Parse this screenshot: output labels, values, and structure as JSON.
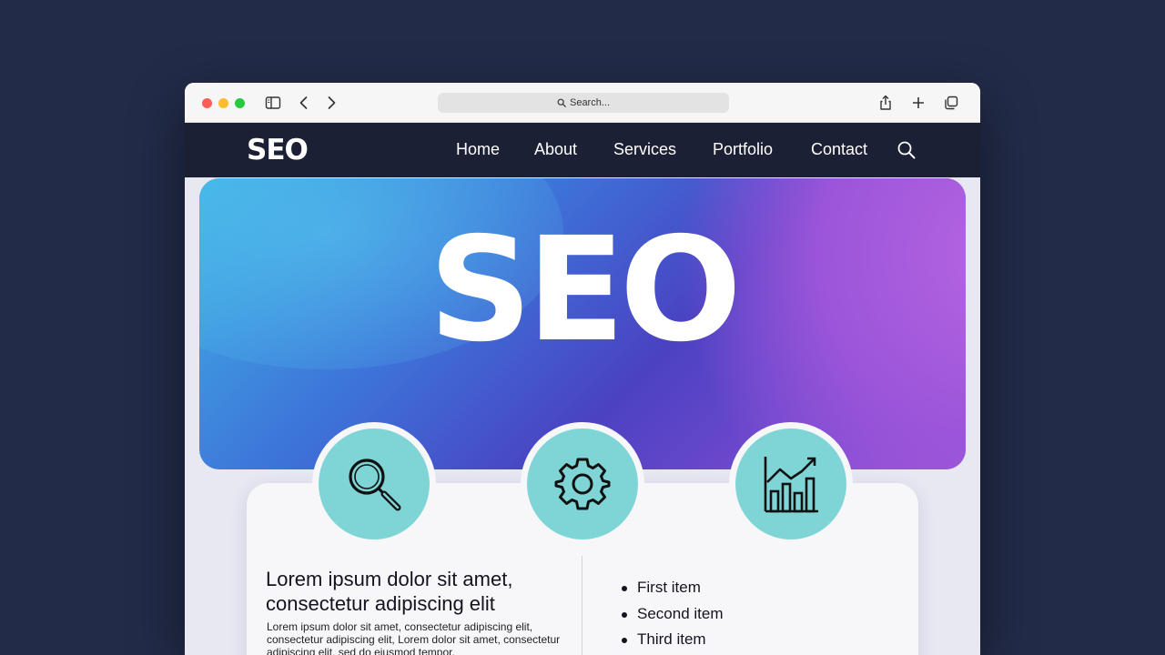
{
  "browser": {
    "address_bar_text": "Search...",
    "icons": [
      "sidebar-icon",
      "back-icon",
      "forward-icon",
      "share-icon",
      "new-tab-icon",
      "tabs-overview-icon"
    ]
  },
  "site_nav": {
    "logo": "SEO",
    "links": [
      "Home",
      "About",
      "Services",
      "Portfolio",
      "Contact"
    ],
    "search_icon": "search-icon"
  },
  "hero": {
    "title": "SEO"
  },
  "features": [
    {
      "icon": "magnifier-icon"
    },
    {
      "icon": "gear-icon"
    },
    {
      "icon": "growth-chart-icon"
    }
  ],
  "content": {
    "heading": "Lorem ipsum dolor sit amet, consectetur adipiscing elit",
    "body": "Lorem ipsum dolor sit amet, consectetur adipiscing elit, consectetur adipiscing elit, Lorem dolor sit amet, consectetur adipiscing elit, sed do eiusmod tempor.",
    "list": [
      "First item",
      "Second item",
      "Third item"
    ]
  },
  "colors": {
    "page_background": "#222b48",
    "navbar": "#1b2034",
    "feature_circle": "#7fd5d6",
    "hero_gradient_start": "#3fb3e6",
    "hero_gradient_end": "#a055d6"
  }
}
